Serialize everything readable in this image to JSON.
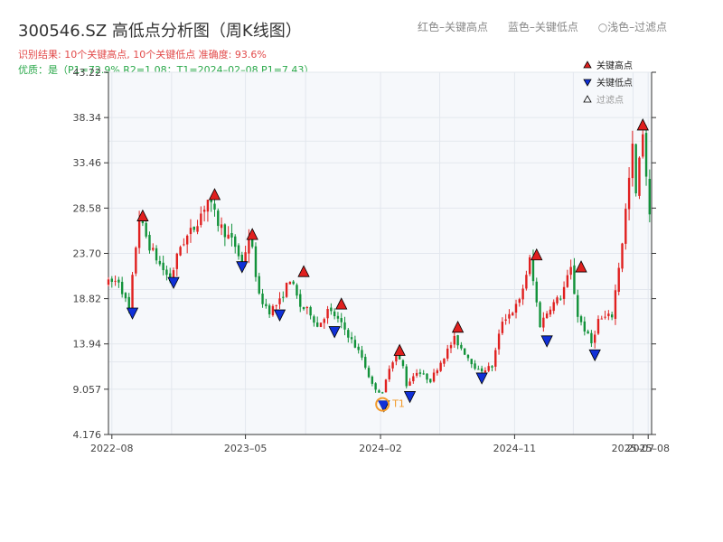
{
  "header": {
    "title": "300546.SZ 高低点分析图（周K线图）",
    "legend_red": "红色–关键高点",
    "legend_blue": "蓝色–关键低点",
    "legend_light": "○浅色–过滤点",
    "result_line": "识别结果: 10个关键高点, 10个关键低点   准确度: 93.6%",
    "quality_line": "优质：是（P1=72.9%  R2=1.08；T1=2024–02–08 P1=7.43）"
  },
  "colors": {
    "up": "#e0201f",
    "down": "#12923a",
    "high_marker": "#e0201f",
    "low_marker": "#1030d8",
    "t1": "#f29a2b",
    "grid": "#e3e7ee",
    "plot_bg": "#f6f8fb"
  },
  "chart_data": {
    "type": "candlestick",
    "y_ticks": [
      "4.176",
      "9.057",
      "13.94",
      "18.82",
      "23.70",
      "28.58",
      "33.46",
      "38.34",
      "43.22"
    ],
    "ylim": [
      4.176,
      43.22
    ],
    "x_ticks": [
      {
        "label": "2022–08",
        "date": "2022-08-01"
      },
      {
        "label": "2023–05",
        "date": "2023-05-01"
      },
      {
        "label": "2024–02",
        "date": "2024-02-01"
      },
      {
        "label": "2024–11",
        "date": "2024-11-01"
      },
      {
        "label": "2025–07",
        "date": "2025-07-01"
      },
      {
        "label": "2025–08",
        "date": "2025-08-01"
      }
    ],
    "xlim": [
      "2022-07-25",
      "2025-08-08"
    ],
    "legend": [
      {
        "label": "关键高点",
        "kind": "high"
      },
      {
        "label": "关键低点",
        "kind": "low"
      },
      {
        "label": "过滤点",
        "kind": "filtered"
      }
    ],
    "price_path": [
      [
        "2022-07-25",
        20.5
      ],
      [
        "2022-08-15",
        20.8
      ],
      [
        "2022-09-05",
        17.5
      ],
      [
        "2022-09-19",
        24.5
      ],
      [
        "2022-09-26",
        27.5
      ],
      [
        "2022-10-17",
        24.5
      ],
      [
        "2022-11-07",
        22.5
      ],
      [
        "2022-11-28",
        20.8
      ],
      [
        "2022-12-19",
        24.5
      ],
      [
        "2023-01-16",
        26.5
      ],
      [
        "2023-02-13",
        29.5
      ],
      [
        "2023-03-06",
        27.0
      ],
      [
        "2023-04-10",
        24.5
      ],
      [
        "2023-04-24",
        22.5
      ],
      [
        "2023-05-08",
        25.5
      ],
      [
        "2023-05-15",
        24.0
      ],
      [
        "2023-05-29",
        19.0
      ],
      [
        "2023-06-19",
        17.5
      ],
      [
        "2023-07-10",
        18.5
      ],
      [
        "2023-07-31",
        21.0
      ],
      [
        "2023-08-21",
        18.0
      ],
      [
        "2023-09-11",
        17.3
      ],
      [
        "2023-09-25",
        15.8
      ],
      [
        "2023-10-16",
        17.5
      ],
      [
        "2023-10-30",
        17.0
      ],
      [
        "2023-11-20",
        15.5
      ],
      [
        "2023-12-25",
        12.5
      ],
      [
        "2024-01-15",
        9.5
      ],
      [
        "2024-02-05",
        8.5
      ],
      [
        "2024-02-19",
        11.5
      ],
      [
        "2024-03-04",
        12.8
      ],
      [
        "2024-03-18",
        11.5
      ],
      [
        "2024-03-25",
        9.5
      ],
      [
        "2024-04-15",
        11.0
      ],
      [
        "2024-05-13",
        10.0
      ],
      [
        "2024-06-03",
        12.0
      ],
      [
        "2024-07-01",
        14.5
      ],
      [
        "2024-07-22",
        13.0
      ],
      [
        "2024-08-19",
        11.0
      ],
      [
        "2024-09-16",
        11.5
      ],
      [
        "2024-10-07",
        16.5
      ],
      [
        "2024-10-28",
        17.5
      ],
      [
        "2024-11-11",
        18.5
      ],
      [
        "2024-12-02",
        23.0
      ],
      [
        "2024-12-23",
        16.0
      ],
      [
        "2025-01-13",
        18.0
      ],
      [
        "2025-02-03",
        19.0
      ],
      [
        "2025-02-24",
        22.0
      ],
      [
        "2025-03-10",
        17.0
      ],
      [
        "2025-04-07",
        14.0
      ],
      [
        "2025-04-21",
        16.5
      ],
      [
        "2025-05-19",
        17.0
      ],
      [
        "2025-06-09",
        25.0
      ],
      [
        "2025-06-30",
        35.0
      ],
      [
        "2025-07-07",
        30.0
      ],
      [
        "2025-07-21",
        37.0
      ],
      [
        "2025-08-04",
        27.5
      ]
    ],
    "key_highs": [
      {
        "date": "2022-10-03",
        "price": 27.0
      },
      {
        "date": "2023-02-27",
        "price": 29.3
      },
      {
        "date": "2023-05-15",
        "price": 25.0
      },
      {
        "date": "2023-08-28",
        "price": 21.0
      },
      {
        "date": "2023-11-13",
        "price": 17.5
      },
      {
        "date": "2024-03-11",
        "price": 12.5
      },
      {
        "date": "2024-07-08",
        "price": 15.0
      },
      {
        "date": "2024-12-16",
        "price": 22.8
      },
      {
        "date": "2025-03-17",
        "price": 21.5
      },
      {
        "date": "2025-07-21",
        "price": 36.8
      }
    ],
    "key_lows": [
      {
        "date": "2022-09-12",
        "price": 18.0
      },
      {
        "date": "2022-12-05",
        "price": 21.3
      },
      {
        "date": "2023-04-24",
        "price": 23.0
      },
      {
        "date": "2023-07-10",
        "price": 17.8
      },
      {
        "date": "2023-10-30",
        "price": 16.0
      },
      {
        "date": "2024-02-08",
        "price": 8.0
      },
      {
        "date": "2024-04-01",
        "price": 9.0
      },
      {
        "date": "2024-08-26",
        "price": 11.0
      },
      {
        "date": "2025-01-06",
        "price": 15.0
      },
      {
        "date": "2025-04-14",
        "price": 13.5
      }
    ],
    "t1": {
      "label": "T1",
      "date": "2024-02-05",
      "price": 7.43
    }
  }
}
